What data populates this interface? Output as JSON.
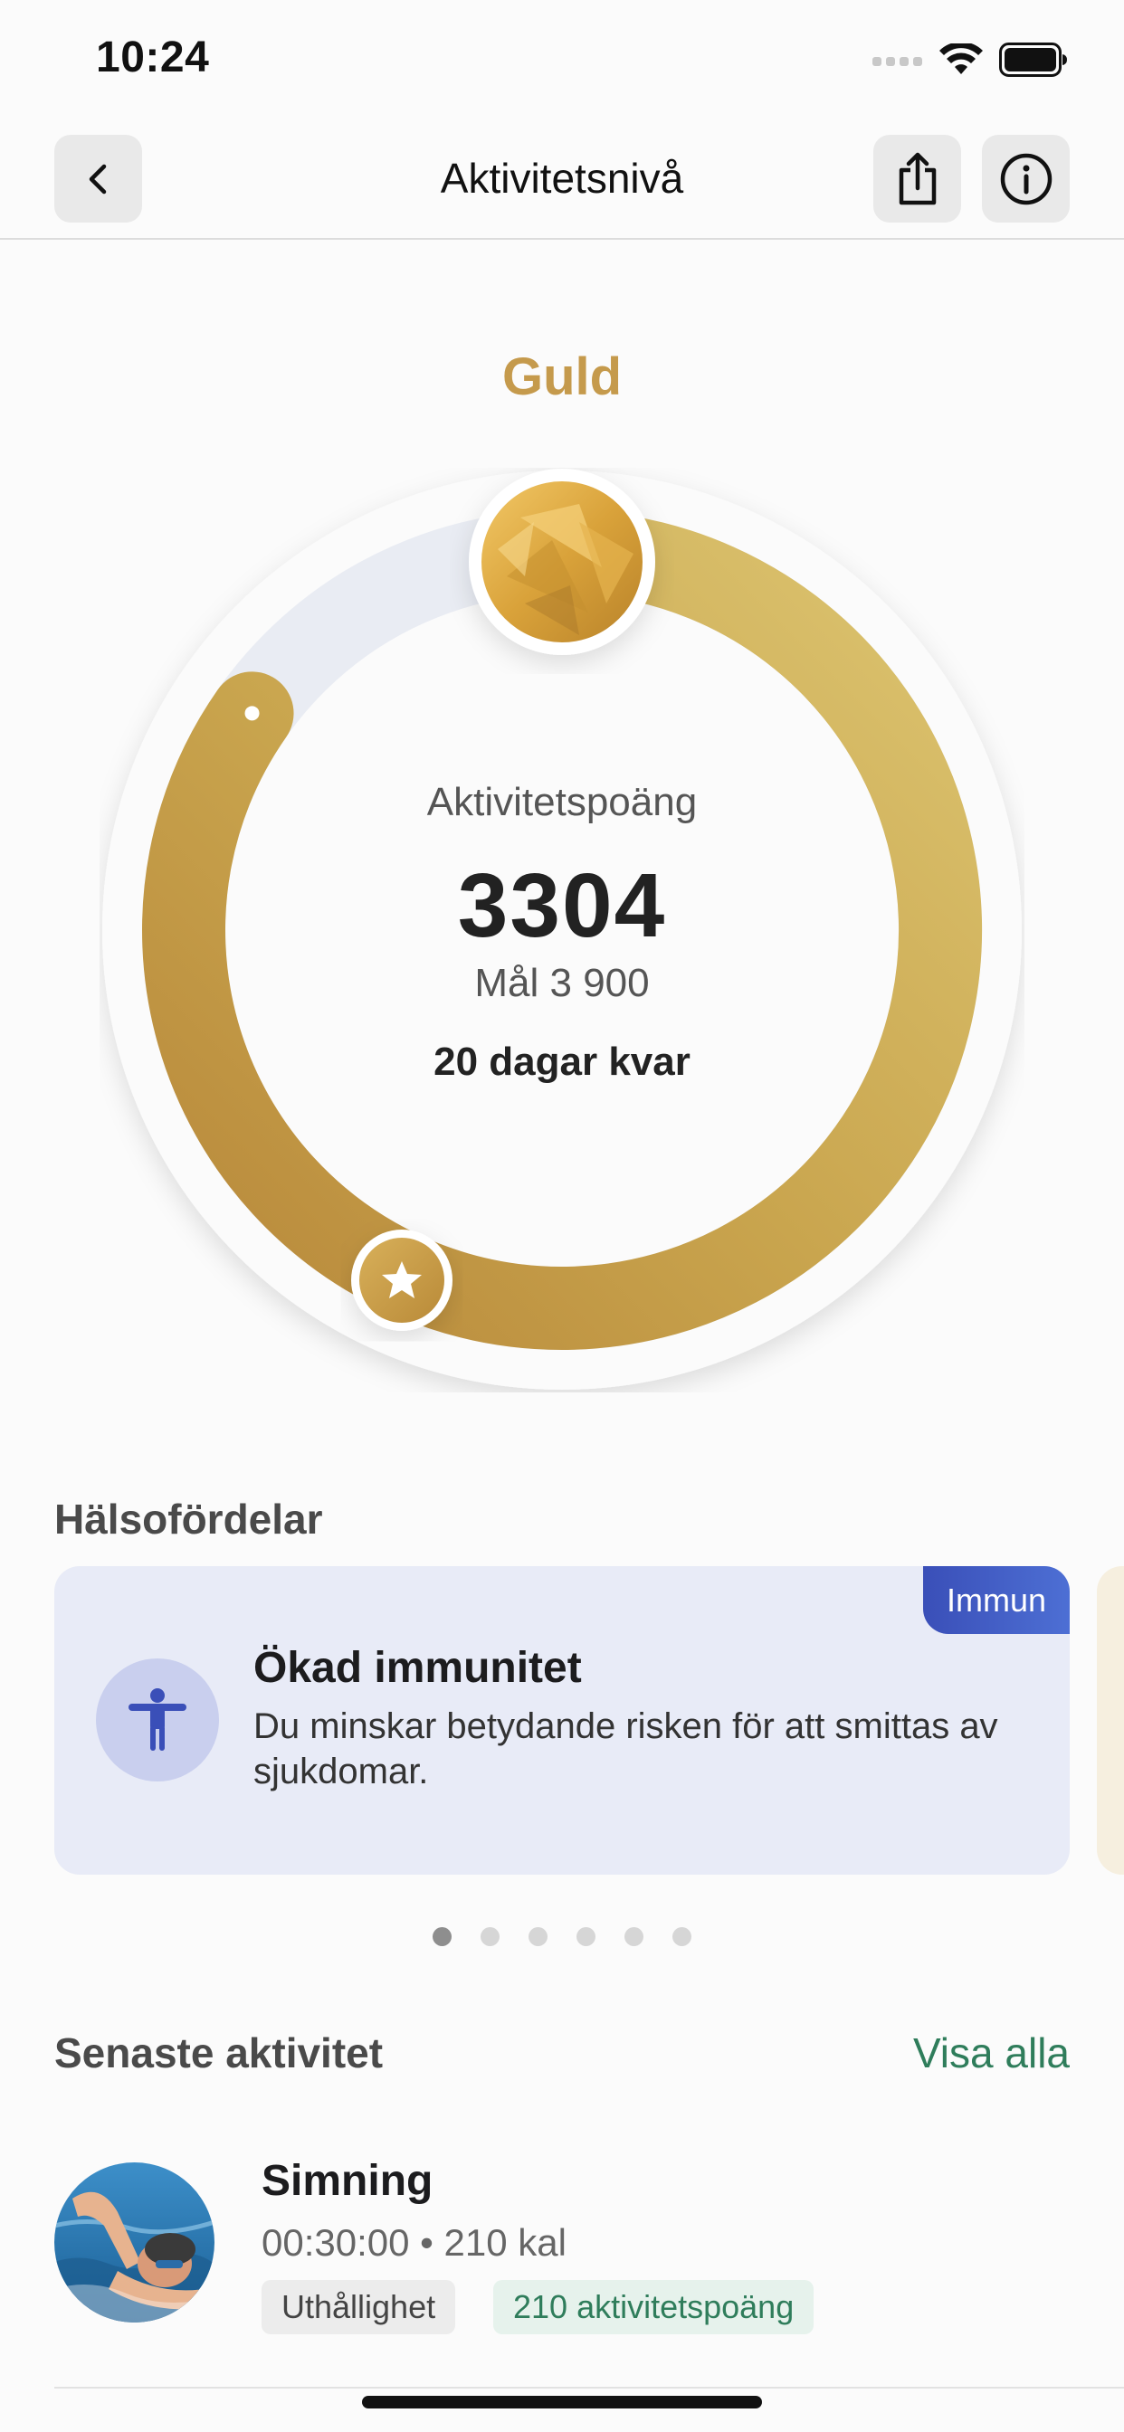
{
  "status_bar": {
    "time": "10:24",
    "icons": [
      "cellular-signal-icon",
      "wifi-icon",
      "battery-icon"
    ]
  },
  "header": {
    "title": "Aktivitetsnivå",
    "buttons": [
      "back-icon",
      "share-icon",
      "info-icon"
    ]
  },
  "level": {
    "name": "Guld",
    "color": "#c59a4c",
    "score_label": "Aktivitetspoäng",
    "score": "3304",
    "goal": "Mål 3 900",
    "days_left": "20 dagar kvar",
    "progress": {
      "value": 3304,
      "goal": 3900
    },
    "badge_icon": "gold-medal-icon",
    "milestone_icon": "star-icon"
  },
  "benefits": {
    "title": "Hälsofördelar",
    "cards": [
      {
        "tag": "Immun",
        "heading": "Ökad immunitet",
        "text": "Du minskar betydande risken för att smittas av sjukdomar.",
        "icon": "person-icon",
        "accent": "#3a4fb8"
      }
    ],
    "page_count": 6,
    "active_page": 0
  },
  "recent": {
    "title": "Senaste aktivitet",
    "see_all": "Visa alla",
    "items": [
      {
        "name": "Simning",
        "meta": "00:30:00 • 210 kal",
        "tag": "Uthållighet",
        "points": "210 aktivitetspoäng",
        "icon": "swimmer-avatar"
      }
    ]
  }
}
